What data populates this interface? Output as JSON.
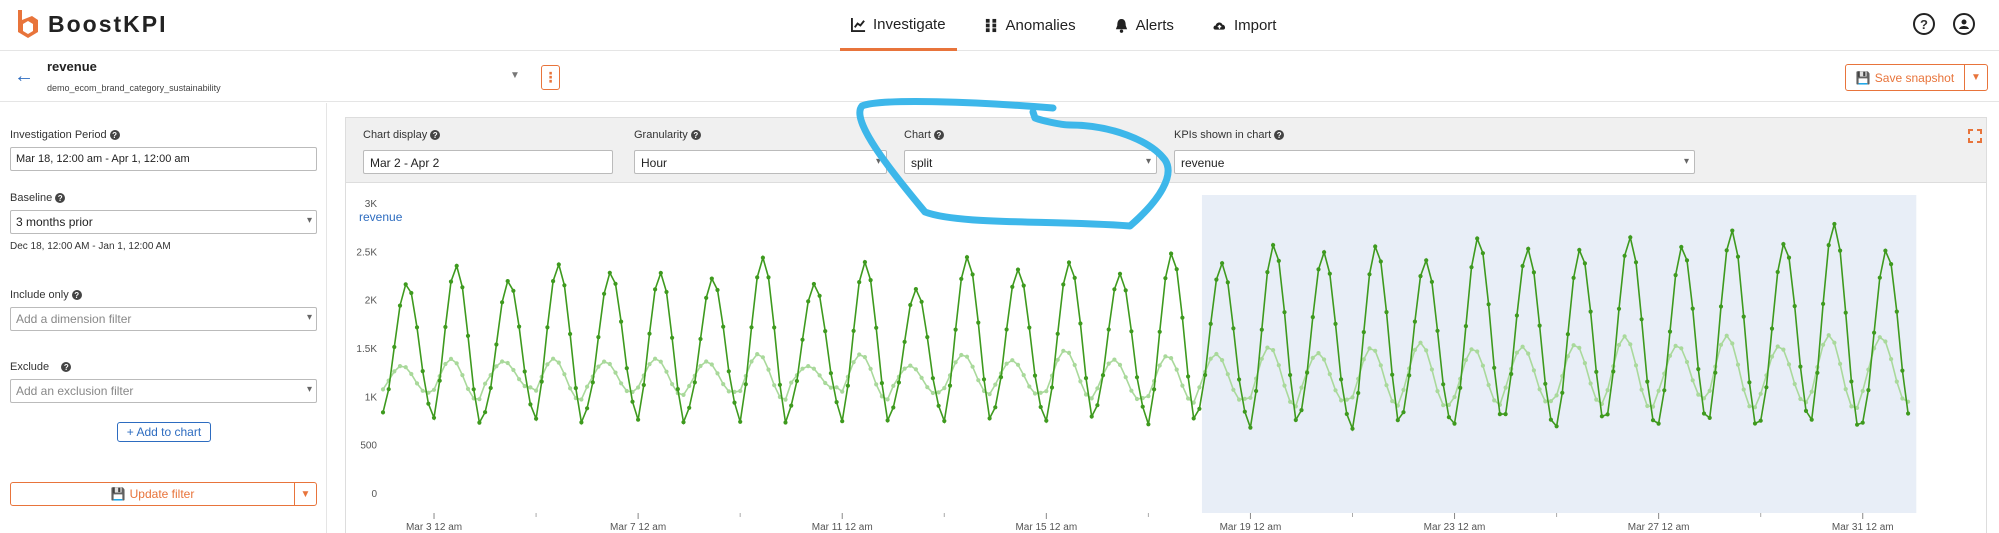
{
  "app": {
    "brand": "BoostKPI"
  },
  "nav": [
    {
      "label": "Investigate",
      "icon": "line-chart-icon",
      "active": true
    },
    {
      "label": "Anomalies",
      "icon": "grid-icon",
      "active": false
    },
    {
      "label": "Alerts",
      "icon": "bell-icon",
      "active": false
    },
    {
      "label": "Import",
      "icon": "cloud-upload-icon",
      "active": false
    }
  ],
  "header": {
    "kpi_name": "revenue",
    "kpi_source": "demo_ecom_brand_category_sustainability",
    "save_label": "Save snapshot"
  },
  "left": {
    "period_label": "Investigation Period",
    "period_value": "Mar 18, 12:00 am  - Apr 1, 12:00 am",
    "baseline_label": "Baseline",
    "baseline_value": "3 months prior",
    "baseline_range": "Dec 18, 12:00 AM - Jan 1, 12:00 AM",
    "include_label": "Include only",
    "include_placeholder": "Add a dimension filter",
    "exclude_label": "Exclude",
    "exclude_placeholder": "Add an exclusion filter",
    "add_to_chart": "+ Add to chart",
    "update_filter": "Update filter"
  },
  "controls": {
    "chart_display_label": "Chart display",
    "chart_display_value": "Mar 2 - Apr 2",
    "granularity_label": "Granularity",
    "granularity_value": "Hour",
    "chart_label": "Chart",
    "chart_value": "split",
    "kpis_label": "KPIs shown in chart",
    "kpis_value": "revenue"
  },
  "colors": {
    "accent": "#e8743b",
    "link": "#2d6cc0",
    "series_current": "#3e9a1e",
    "series_baseline": "#a9d99b",
    "highlight": "#e8eef7",
    "annotation": "#3db7ea"
  },
  "chart_data": {
    "type": "line",
    "title": "revenue",
    "ylim": [
      0,
      3000
    ],
    "yticks": [
      "0",
      "500",
      "1K",
      "1.5K",
      "2K",
      "2.5K",
      "3K"
    ],
    "xticks": [
      "Mar 3 12 am",
      "Mar 7 12 am",
      "Mar 11 12 am",
      "Mar 15 12 am",
      "Mar 19 12 am",
      "Mar 23 12 am",
      "Mar 27 12 am",
      "Mar 31 12 am"
    ],
    "x_range": [
      "Mar 2",
      "Apr 2"
    ],
    "highlight_range": [
      "Mar 18",
      "Apr 1"
    ],
    "series": [
      {
        "role": "current",
        "daily_peaks": [
          2200,
          2300,
          2250,
          2300,
          2350,
          2200,
          2300,
          2350,
          2250,
          2300,
          2200,
          2350,
          2400,
          2300,
          2350,
          2400,
          2450,
          2500,
          2550,
          2500,
          2450,
          2600,
          2550,
          2500,
          2650,
          2550,
          2700,
          2600,
          2750,
          2550
        ],
        "daily_troughs": [
          800,
          750,
          780,
          760,
          800,
          770,
          790,
          760,
          800,
          780,
          770,
          790,
          760,
          800,
          780,
          760,
          740,
          720,
          730,
          700,
          720,
          740,
          710,
          700,
          720,
          710,
          700,
          720,
          700,
          680
        ]
      },
      {
        "role": "baseline",
        "daily_peaks": [
          1350,
          1350,
          1400,
          1350,
          1400,
          1350,
          1400,
          1400,
          1350,
          1400,
          1350,
          1400,
          1400,
          1450,
          1400,
          1400,
          1450,
          1500,
          1450,
          1500,
          1550,
          1500,
          1500,
          1550,
          1600,
          1550,
          1600,
          1550,
          1600,
          1650
        ],
        "daily_troughs": [
          1000,
          1000,
          1050,
          1000,
          1000,
          1050,
          1000,
          1000,
          1050,
          1000,
          1000,
          1050,
          1000,
          1000,
          950,
          950,
          950,
          900,
          950,
          900,
          900,
          900,
          950,
          900,
          900,
          950,
          900,
          900,
          900,
          900
        ]
      }
    ]
  }
}
